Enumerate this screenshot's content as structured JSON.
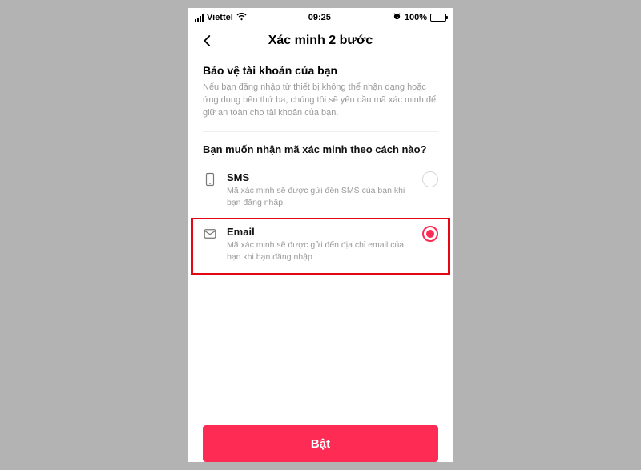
{
  "status_bar": {
    "carrier": "Viettel",
    "time": "09:25",
    "battery_pct": "100%"
  },
  "nav": {
    "title": "Xác minh 2 bước"
  },
  "intro": {
    "title": "Bảo vệ tài khoản của bạn",
    "desc": "Nếu bạn đăng nhập từ thiết bị không thể nhận dạng hoặc ứng dụng bên thứ ba, chúng tôi sẽ yêu cầu mã xác minh để giữ an toàn cho tài khoản của bạn."
  },
  "question": "Bạn muốn nhận mã xác minh theo cách nào?",
  "options": {
    "sms": {
      "label": "SMS",
      "desc": "Mã xác minh sẽ được gửi đến SMS của bạn khi bạn đăng nhập."
    },
    "email": {
      "label": "Email",
      "desc": "Mã xác minh sẽ được gửi đến địa chỉ email của bạn khi bạn đăng nhập."
    }
  },
  "footer": {
    "primary_label": "Bật"
  }
}
